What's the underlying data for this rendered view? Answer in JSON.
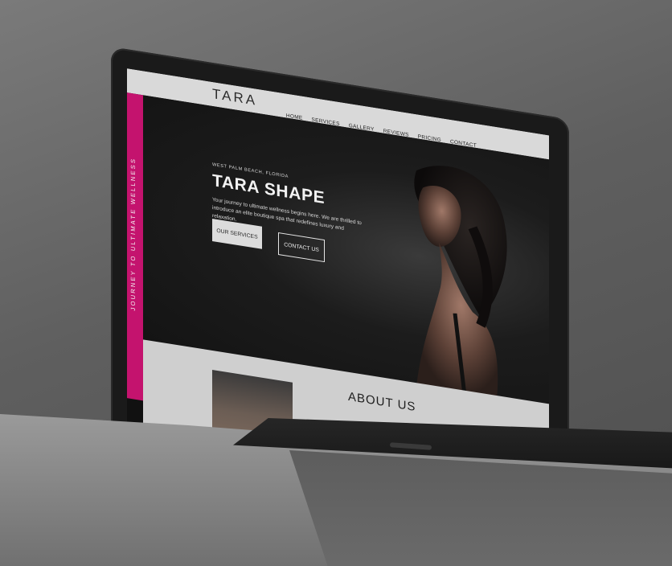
{
  "site": {
    "logo": "TARA",
    "nav": [
      "HOME",
      "SERVICES",
      "GALLERY",
      "REVIEWS",
      "PRICING",
      "CONTACT"
    ],
    "side_banner": "JOURNEY TO ULTIMATE WELLNESS",
    "hero": {
      "location": "WEST PALM BEACH, FLORIDA",
      "title": "TARA SHAPE",
      "description": "Your journey to ultimate wellness begins here. We are thrilled to introduce an elite boutique spa that redefines luxury and relaxation.",
      "primary_button": "OUR SERVICES",
      "secondary_button": "CONTACT US"
    },
    "about": {
      "title": "ABOUT US"
    }
  },
  "colors": {
    "accent": "#c4136e",
    "hero_bg": "#141414",
    "nav_bg": "#d9d9d9"
  }
}
